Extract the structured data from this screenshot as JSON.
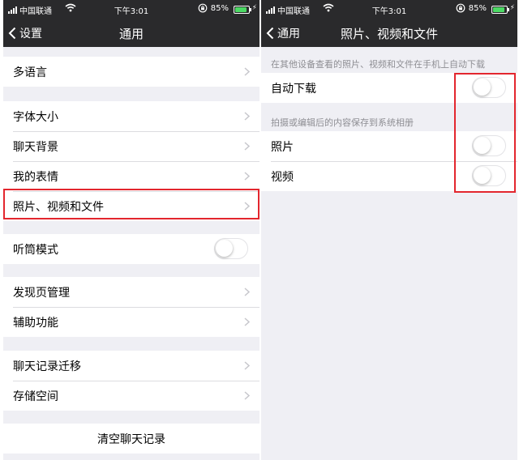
{
  "status_bar": {
    "carrier": "中国联通",
    "time": "下午3:01",
    "battery": "85%",
    "battery_level": 0.85
  },
  "left_screen": {
    "back_label": "设置",
    "title": "通用",
    "groups": [
      [
        {
          "label": "多语言",
          "accessory": "chevron"
        }
      ],
      [
        {
          "label": "字体大小",
          "accessory": "chevron"
        },
        {
          "label": "聊天背景",
          "accessory": "chevron"
        },
        {
          "label": "我的表情",
          "accessory": "chevron"
        },
        {
          "label": "照片、视频和文件",
          "accessory": "chevron"
        }
      ],
      [
        {
          "label": "听筒模式",
          "accessory": "toggle",
          "on": false
        }
      ],
      [
        {
          "label": "发现页管理",
          "accessory": "chevron"
        },
        {
          "label": "辅助功能",
          "accessory": "chevron"
        }
      ],
      [
        {
          "label": "聊天记录迁移",
          "accessory": "chevron"
        },
        {
          "label": "存储空间",
          "accessory": "chevron"
        }
      ],
      [
        {
          "label": "清空聊天记录",
          "accessory": "none"
        }
      ]
    ]
  },
  "right_screen": {
    "back_label": "通用",
    "title": "照片、视频和文件",
    "note_1": "在其他设备查看的照片、视频和文件在手机上自动下载",
    "auto_download_label": "自动下载",
    "auto_download_on": false,
    "note_2": "拍摄或编辑后的内容保存到系统相册",
    "photos_label": "照片",
    "photos_on": false,
    "videos_label": "视频",
    "videos_on": false
  },
  "colors": {
    "nav_bar": "#2a2a2c",
    "background": "#efeff4",
    "highlight_red": "#e3262e",
    "note_text": "#8e8e93"
  }
}
